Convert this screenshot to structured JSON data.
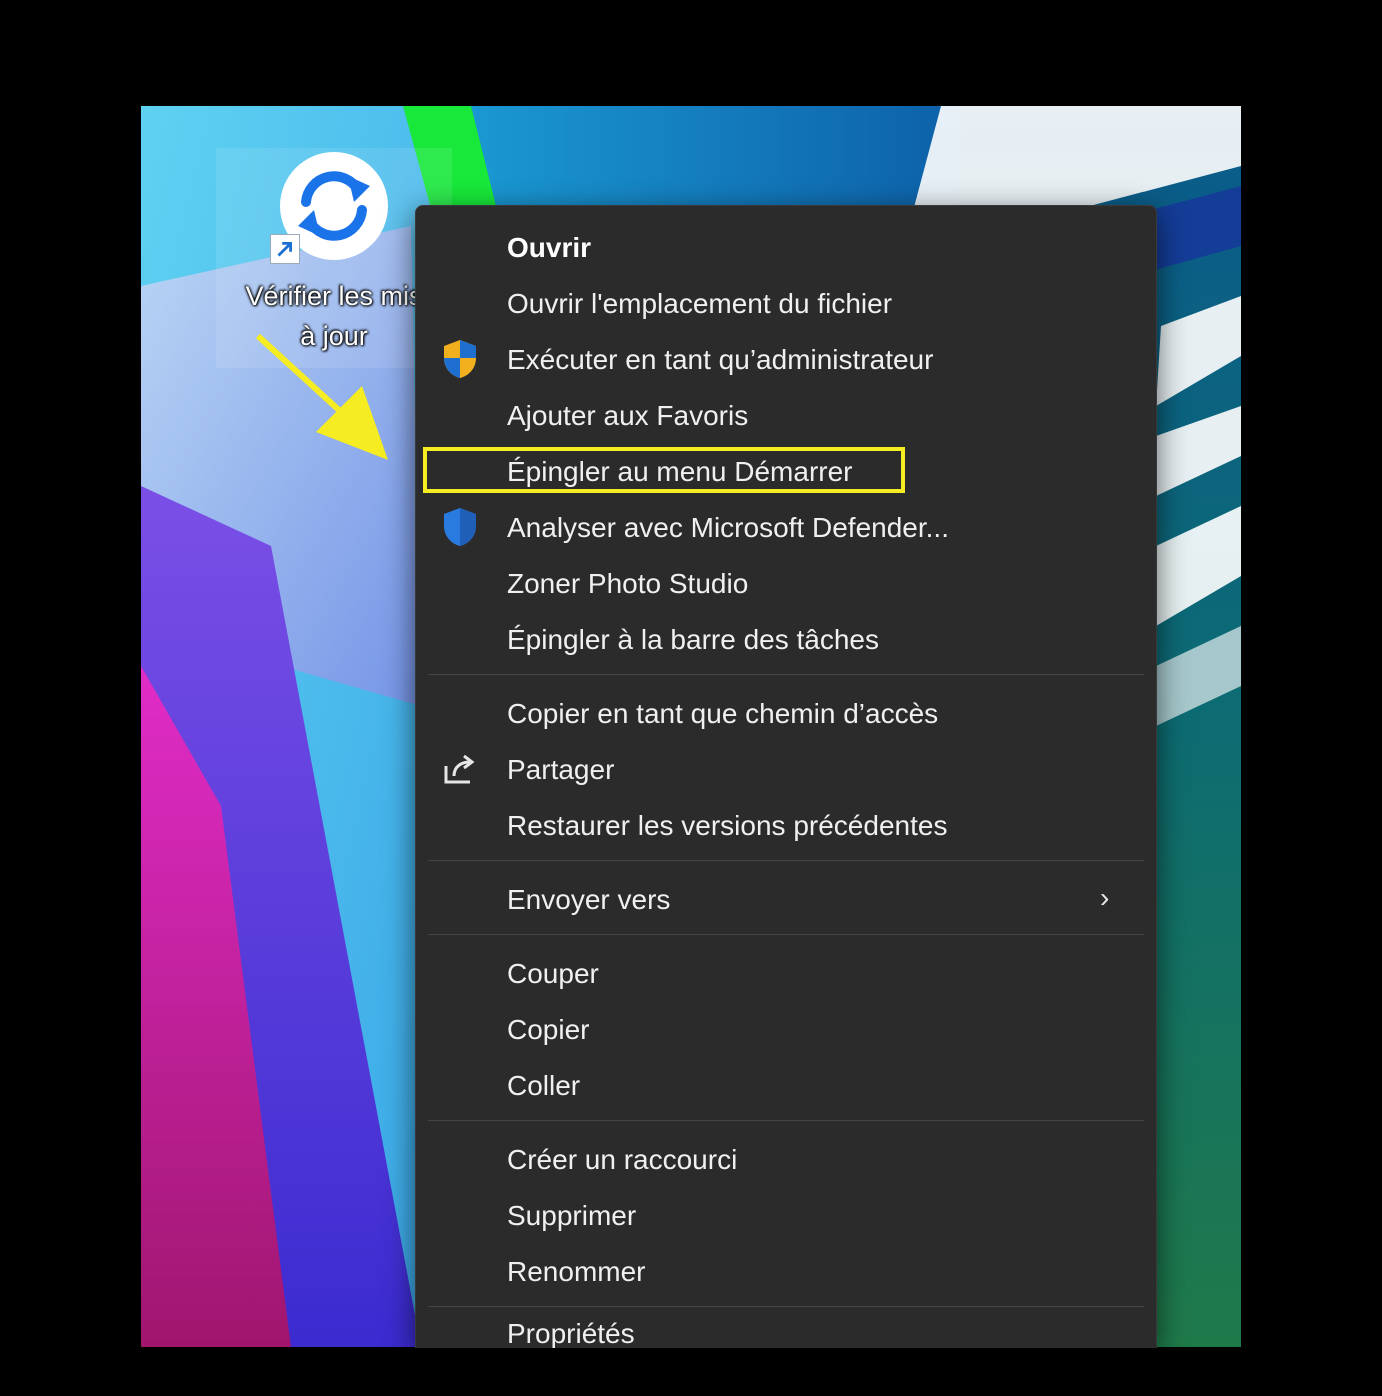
{
  "desktop_icon": {
    "label_line1": "Vérifier les mis",
    "label_line2": "à jour",
    "icon": "refresh-icon"
  },
  "context_menu": {
    "groups": [
      [
        {
          "label": "Ouvrir",
          "bold": true
        },
        {
          "label": "Ouvrir l'emplacement du fichier"
        },
        {
          "label": "Exécuter en tant qu’administrateur",
          "icon": "uac-shield-icon"
        },
        {
          "label": "Ajouter aux Favoris"
        },
        {
          "label": "Épingler au menu Démarrer",
          "highlighted": true
        },
        {
          "label": "Analyser avec Microsoft Defender...",
          "icon": "defender-shield-icon"
        },
        {
          "label": "Zoner Photo Studio"
        },
        {
          "label": "Épingler à la barre des tâches"
        }
      ],
      [
        {
          "label": "Copier en tant que chemin d’accès"
        },
        {
          "label": "Partager",
          "icon": "share-icon"
        },
        {
          "label": "Restaurer les versions précédentes"
        }
      ],
      [
        {
          "label": "Envoyer vers",
          "submenu": true,
          "submenu_glyph": "›"
        }
      ],
      [
        {
          "label": "Couper"
        },
        {
          "label": "Copier"
        },
        {
          "label": "Coller"
        }
      ],
      [
        {
          "label": "Créer un raccourci"
        },
        {
          "label": "Supprimer"
        },
        {
          "label": "Renommer"
        }
      ],
      [
        {
          "label": "Propriétés"
        }
      ]
    ]
  },
  "annotation": {
    "highlight_color": "#f5ec21",
    "arrow_color": "#f5ec21"
  }
}
